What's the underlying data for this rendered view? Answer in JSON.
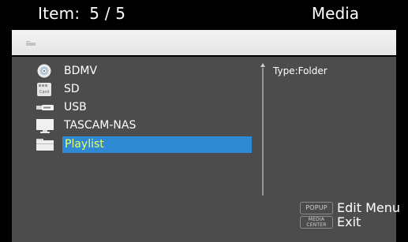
{
  "header": {
    "item_label": "Item:",
    "item_count": "5 / 5",
    "title": "Media"
  },
  "pathbar": {
    "icon": "folder-icon"
  },
  "list": {
    "items": [
      {
        "label": "BDMV",
        "icon": "disc-icon"
      },
      {
        "label": "SD",
        "icon": "sd-card-icon"
      },
      {
        "label": "USB",
        "icon": "usb-drive-icon"
      },
      {
        "label": "TASCAM-NAS",
        "icon": "monitor-icon"
      },
      {
        "label": "Playlist",
        "icon": "folder-icon",
        "selected": true
      }
    ]
  },
  "info": {
    "type": "Type:Folder"
  },
  "footer": {
    "popup_key": "POPUP",
    "popup_action": "Edit Menu",
    "media_key_line1": "MEDIA",
    "media_key_line2": "CENTER",
    "media_action": "Exit"
  },
  "colors": {
    "selection_bg": "#2f8ad3",
    "selection_text": "#e7ff6b",
    "panel_bg": "#4c4c4c"
  }
}
